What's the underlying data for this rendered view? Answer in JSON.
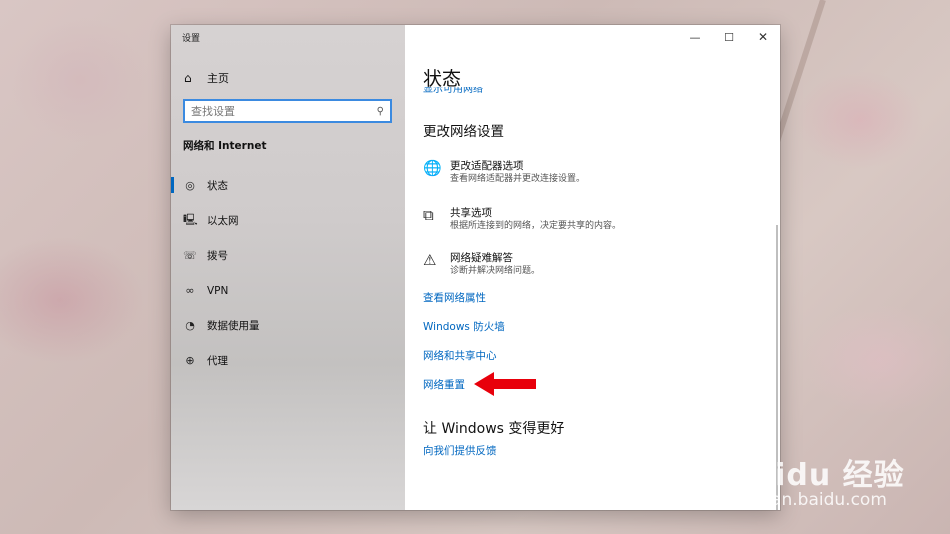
{
  "window": {
    "title": "设置",
    "controls": {
      "minimize": "—",
      "maximize": "☐",
      "close": "✕"
    }
  },
  "sidebar": {
    "home": {
      "label": "主页",
      "icon": "home-icon"
    },
    "search": {
      "placeholder": "查找设置",
      "icon": "search-icon"
    },
    "section_label": "网络和 Internet",
    "items": [
      {
        "label": "状态",
        "icon": "status-icon",
        "active": true
      },
      {
        "label": "以太网",
        "icon": "ethernet-icon",
        "active": false
      },
      {
        "label": "拨号",
        "icon": "dialup-icon",
        "active": false
      },
      {
        "label": "VPN",
        "icon": "vpn-icon",
        "active": false
      },
      {
        "label": "数据使用量",
        "icon": "data-usage-icon",
        "active": false
      },
      {
        "label": "代理",
        "icon": "proxy-globe-icon",
        "active": false
      }
    ]
  },
  "main": {
    "title": "状态",
    "partially_hidden_link": "显示可用网络",
    "change_settings_heading": "更改网络设置",
    "options": [
      {
        "title": "更改适配器选项",
        "desc": "查看网络适配器并更改连接设置。",
        "icon": "adapter-globe-icon"
      },
      {
        "title": "共享选项",
        "desc": "根据所连接到的网络，决定要共享的内容。",
        "icon": "sharing-icon"
      },
      {
        "title": "网络疑难解答",
        "desc": "诊断并解决网络问题。",
        "icon": "warning-icon"
      }
    ],
    "links": [
      "查看网络属性",
      "Windows 防火墙",
      "网络和共享中心",
      "网络重置"
    ],
    "improve_heading": "让 Windows 变得更好",
    "feedback_link": "向我们提供反馈"
  },
  "annotation": {
    "arrow_color": "#e8000b"
  },
  "watermark": {
    "logo": "Baidu 经验",
    "url": "jingyan.baidu.com"
  },
  "colors": {
    "accent": "#0067c0",
    "search_border": "#3b8ae0"
  }
}
